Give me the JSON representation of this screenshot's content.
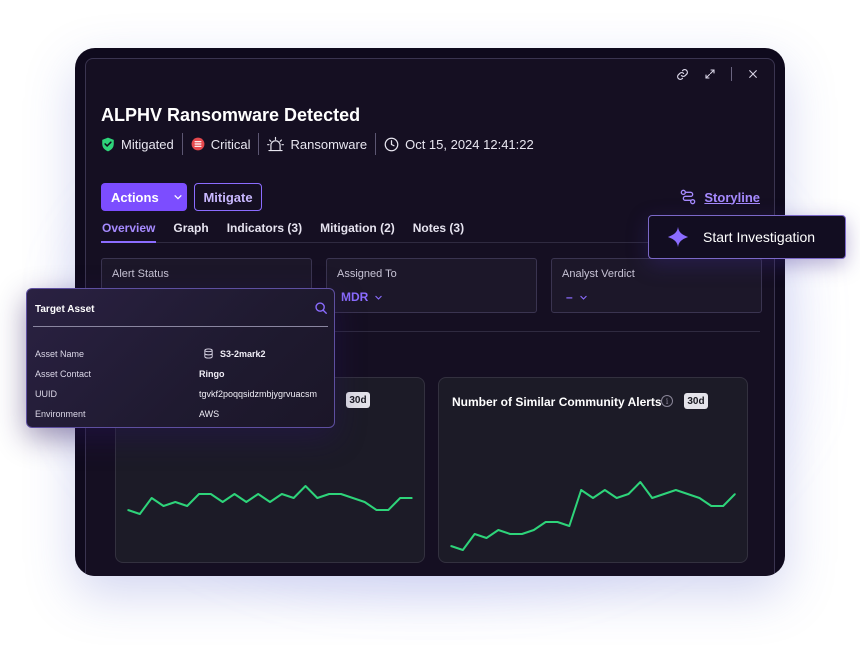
{
  "window": {
    "title": "ALPHV Ransomware Detected",
    "meta": {
      "status": "Mitigated",
      "severity": "Critical",
      "category": "Ransomware",
      "timestamp": "Oct 15, 2024 12:41:22"
    },
    "actions_label": "Actions",
    "mitigate_label": "Mitigate",
    "storyline_label": "Storyline",
    "tabs": [
      {
        "label": "Overview",
        "active": true
      },
      {
        "label": "Graph"
      },
      {
        "label": "Indicators (3)"
      },
      {
        "label": "Mitigation (2)"
      },
      {
        "label": "Notes (3)"
      }
    ],
    "cards": {
      "alert_status": {
        "label": "Alert Status"
      },
      "assigned_to": {
        "label": "Assigned To",
        "value": "MDR"
      },
      "analyst_verdict": {
        "label": "Analyst Verdict",
        "value": "–"
      }
    }
  },
  "charts": {
    "left": {
      "badge": "30d"
    },
    "right": {
      "title": "Number of Similar Community Alerts",
      "badge": "30d"
    }
  },
  "chart_data": [
    {
      "type": "line",
      "title": "",
      "x": [
        1,
        2,
        3,
        4,
        5,
        6,
        7,
        8,
        9,
        10,
        11,
        12,
        13,
        14,
        15,
        16,
        17,
        18,
        19,
        20,
        21,
        22,
        23,
        24,
        25
      ],
      "values": [
        12,
        11,
        15,
        13,
        14,
        13,
        16,
        16,
        14,
        16,
        14,
        16,
        14,
        16,
        15,
        18,
        15,
        16,
        16,
        15,
        14,
        12,
        12,
        15,
        15
      ],
      "color": "#2ed47a"
    },
    {
      "type": "line",
      "title": "Number of Similar Community Alerts",
      "x": [
        1,
        2,
        3,
        4,
        5,
        6,
        7,
        8,
        9,
        10,
        11,
        12,
        13,
        14,
        15,
        16,
        17,
        18,
        19,
        20,
        21,
        22,
        23,
        24,
        25
      ],
      "values": [
        3,
        2,
        6,
        5,
        7,
        6,
        6,
        7,
        9,
        9,
        8,
        17,
        15,
        17,
        15,
        16,
        19,
        15,
        16,
        17,
        16,
        15,
        13,
        13,
        16
      ],
      "color": "#2ed47a"
    }
  ],
  "target_asset": {
    "title": "Target Asset",
    "rows": [
      {
        "label": "Asset Name",
        "value": "S3-2mark2"
      },
      {
        "label": "Asset Contact",
        "value": "Ringo"
      },
      {
        "label": "UUID",
        "value": "tgvkf2poqqsidzmbjygrvuacsm"
      },
      {
        "label": "Environment",
        "value": "AWS"
      }
    ]
  },
  "start_investigation": {
    "label": "Start Investigation"
  },
  "colors": {
    "accent": "#7c4dff",
    "success": "#2ed47a",
    "critical": "#e5484d",
    "background": "#150f22"
  }
}
